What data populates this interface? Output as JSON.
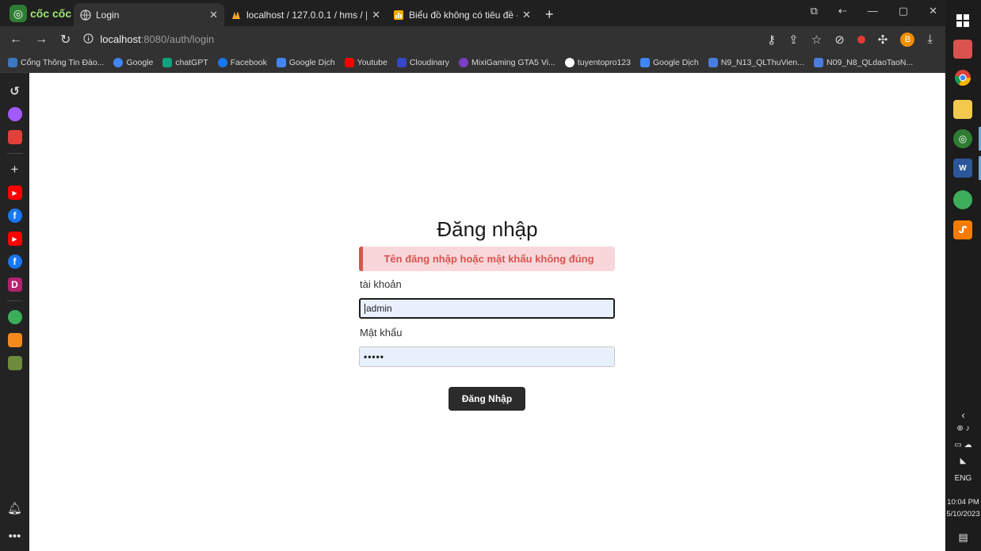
{
  "browser": {
    "brand": "cốc cốc",
    "tabs": [
      {
        "title": "Login"
      },
      {
        "title": "localhost / 127.0.0.1 / hms / |"
      },
      {
        "title": "Biểu đồ không có tiêu đề - d"
      }
    ],
    "new_tab_label": "+",
    "address": {
      "host": "localhost",
      "path": ":8080/auth/login"
    },
    "profile_initial": "B"
  },
  "bookmarks": [
    {
      "label": "Cổng Thông Tin Đào...",
      "color": "#3a78c2"
    },
    {
      "label": "Google",
      "color": "#4285f4"
    },
    {
      "label": "chatGPT",
      "color": "#10a37f"
    },
    {
      "label": "Facebook",
      "color": "#1877f2"
    },
    {
      "label": "Google Dịch",
      "color": "#4285f4"
    },
    {
      "label": "Youtube",
      "color": "#ff0000"
    },
    {
      "label": "Cloudinary",
      "color": "#3448c5"
    },
    {
      "label": "MixiGaming GTA5 Vi...",
      "color": "#7b3fc4"
    },
    {
      "label": "tuyentopro123",
      "color": "#ffffff"
    },
    {
      "label": "Google Dịch",
      "color": "#4285f4"
    },
    {
      "label": "N9_N13_QLThuVien...",
      "color": "#4a7de0"
    },
    {
      "label": "N09_N8_QLdaoTaoN...",
      "color": "#4a7de0"
    }
  ],
  "login": {
    "title": "Đăng nhập",
    "error_message": "Tên đăng nhập hoặc mật khẩu không đúng",
    "username_label": "tài khoản",
    "username_value": "admin",
    "password_label": "Mật khẩu",
    "password_masked": "•••••",
    "submit_label": "Đăng Nhập"
  },
  "taskbar": {
    "language": "ENG",
    "time": "10:04 PM",
    "date": "5/10/2023"
  }
}
